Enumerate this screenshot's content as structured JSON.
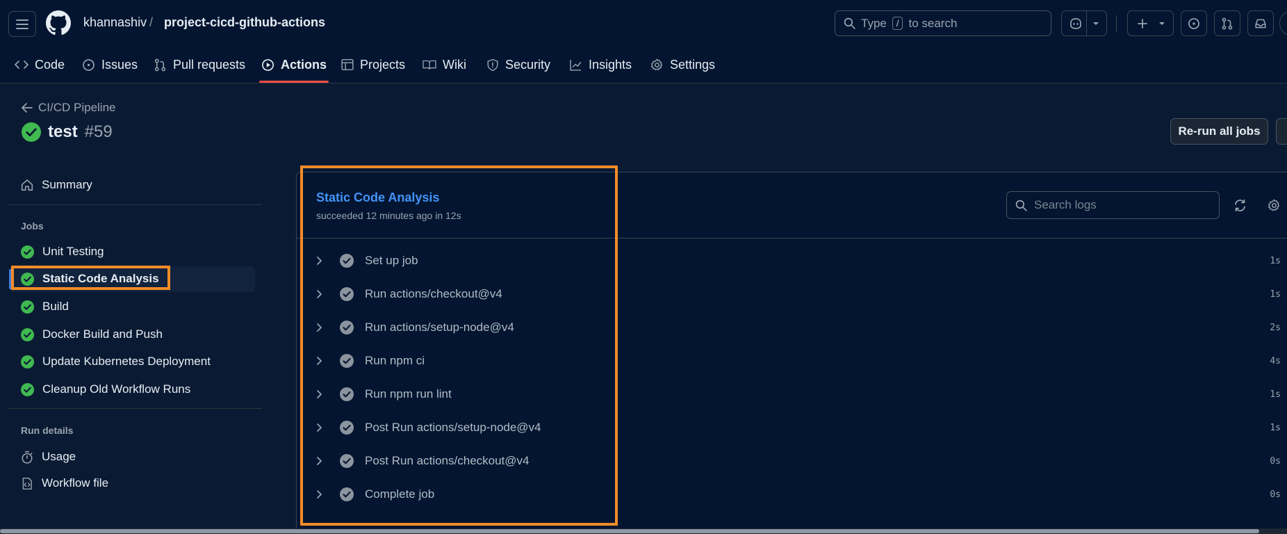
{
  "header": {
    "owner": "khannashiv",
    "separator": "/",
    "repo": "project-cicd-github-actions",
    "search_prefix": "Type",
    "search_key": "/",
    "search_suffix": "to search"
  },
  "nav": {
    "tabs": [
      {
        "label": "Code",
        "icon": "code-icon"
      },
      {
        "label": "Issues",
        "icon": "issue-icon"
      },
      {
        "label": "Pull requests",
        "icon": "pull-request-icon"
      },
      {
        "label": "Actions",
        "icon": "play-icon",
        "active": true
      },
      {
        "label": "Projects",
        "icon": "table-icon"
      },
      {
        "label": "Wiki",
        "icon": "book-icon"
      },
      {
        "label": "Security",
        "icon": "shield-icon"
      },
      {
        "label": "Insights",
        "icon": "graph-icon"
      },
      {
        "label": "Settings",
        "icon": "gear-icon"
      }
    ]
  },
  "run": {
    "workflow": "CI/CD Pipeline",
    "name": "test",
    "number": "#59",
    "rerun_label": "Re-run all jobs"
  },
  "sidebar": {
    "summary": "Summary",
    "jobs_heading": "Jobs",
    "jobs": [
      {
        "label": "Unit Testing",
        "status": "success"
      },
      {
        "label": "Static Code Analysis",
        "status": "success",
        "selected": true
      },
      {
        "label": "Build",
        "status": "success"
      },
      {
        "label": "Docker Build and Push",
        "status": "success"
      },
      {
        "label": "Update Kubernetes Deployment",
        "status": "success"
      },
      {
        "label": "Cleanup Old Workflow Runs",
        "status": "success"
      }
    ],
    "run_details_heading": "Run details",
    "usage": "Usage",
    "workflow_file": "Workflow file"
  },
  "job": {
    "title": "Static Code Analysis",
    "meta": "succeeded 12 minutes ago in 12s",
    "search_placeholder": "Search logs",
    "steps": [
      {
        "label": "Set up job",
        "duration": "1s"
      },
      {
        "label": "Run actions/checkout@v4",
        "duration": "1s"
      },
      {
        "label": "Run actions/setup-node@v4",
        "duration": "2s"
      },
      {
        "label": "Run npm ci",
        "duration": "4s"
      },
      {
        "label": "Run npm run lint",
        "duration": "1s"
      },
      {
        "label": "Post Run actions/setup-node@v4",
        "duration": "1s"
      },
      {
        "label": "Post Run actions/checkout@v4",
        "duration": "0s"
      },
      {
        "label": "Complete job",
        "duration": "0s"
      }
    ]
  },
  "colors": {
    "accent_link": "#4493f8",
    "success": "#3fb950",
    "highlight": "#f28c28",
    "active_underline": "#f85149"
  }
}
